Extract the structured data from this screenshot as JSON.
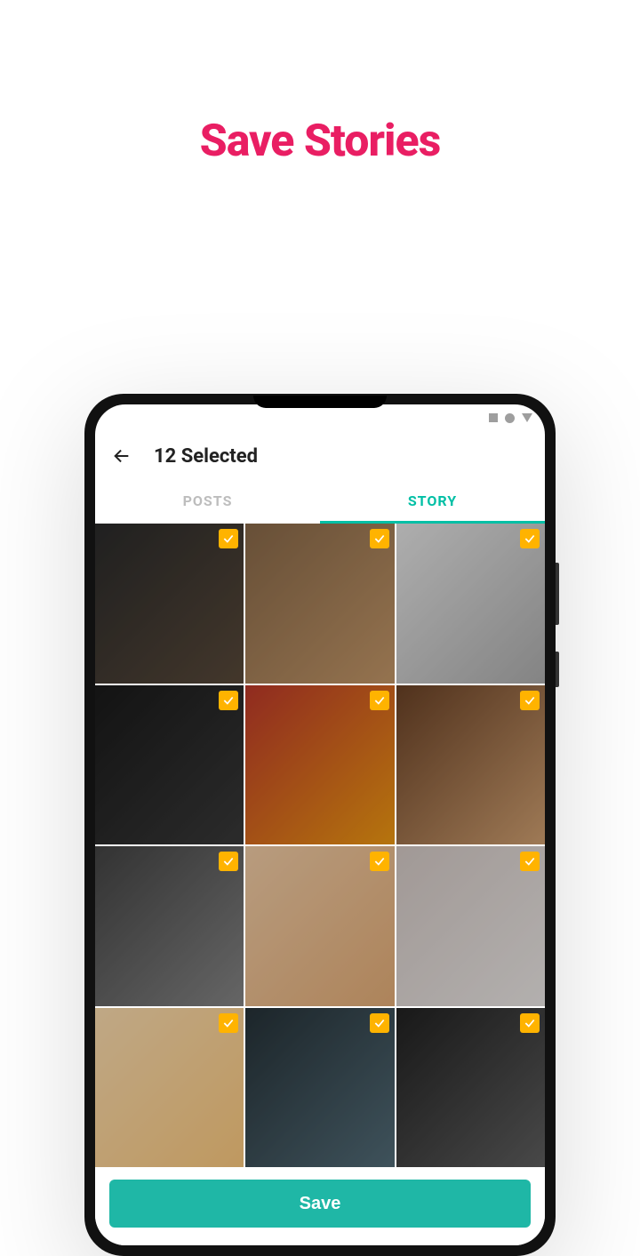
{
  "headline": "Save Stories",
  "colors": {
    "accent": "#00bfa5",
    "headline": "#e91e63",
    "check": "#ffb300",
    "save_button": "#1fb7a6"
  },
  "app": {
    "title": "12 Selected",
    "tabs": {
      "posts": "POSTS",
      "story": "STORY",
      "active": "story"
    },
    "save_label": "Save",
    "items": [
      {
        "selected": true
      },
      {
        "selected": true
      },
      {
        "selected": true
      },
      {
        "selected": true
      },
      {
        "selected": true
      },
      {
        "selected": true
      },
      {
        "selected": true
      },
      {
        "selected": true
      },
      {
        "selected": true
      },
      {
        "selected": true
      },
      {
        "selected": true
      },
      {
        "selected": true
      }
    ]
  }
}
